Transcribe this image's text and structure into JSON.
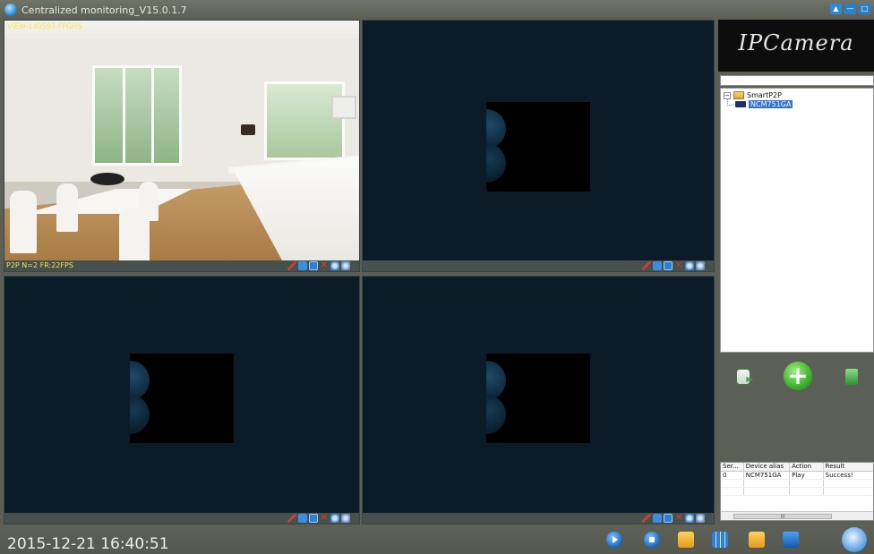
{
  "window": {
    "title": "Centralized monitoring_V15.0.1.7"
  },
  "panes": [
    {
      "top_left": "VIEW-140593-FFGHS",
      "bottom_left": "P2P N=2 FR:22FPS"
    },
    {
      "top_left": "",
      "bottom_left": ""
    },
    {
      "top_left": "",
      "bottom_left": ""
    },
    {
      "top_left": "",
      "bottom_left": ""
    }
  ],
  "sidebar": {
    "logo_text": "IPCamera",
    "search_value": "",
    "tree": {
      "root_label": "SmartP2P",
      "device_label": "NCM751GA"
    }
  },
  "log": {
    "columns": [
      "Ser...",
      "Device alias",
      "Action",
      "Result"
    ],
    "rows": [
      [
        "0",
        "NCM751GA",
        "Play",
        "Success!"
      ]
    ],
    "scroll_marker": "III"
  },
  "statusbar": {
    "datetime": "2015-12-21 16:40:51"
  },
  "icons": {
    "window_controls": [
      "shirt-icon",
      "minimize-icon",
      "maximize-icon"
    ],
    "pane_controls": [
      "pen-icon",
      "speaker-icon",
      "camera-icon",
      "record-stop-icon",
      "ptz-icon",
      "fullscreen-icon"
    ],
    "toolbar": [
      "play-icon",
      "stop-icon",
      "folder-video-icon",
      "grid-layout-icon",
      "folder-image-icon",
      "monitor-icon",
      "tools-icon"
    ]
  },
  "colors": {
    "overlay_text": "#f2e44a",
    "background": "#5c5f55",
    "selection": "#3372d6"
  }
}
